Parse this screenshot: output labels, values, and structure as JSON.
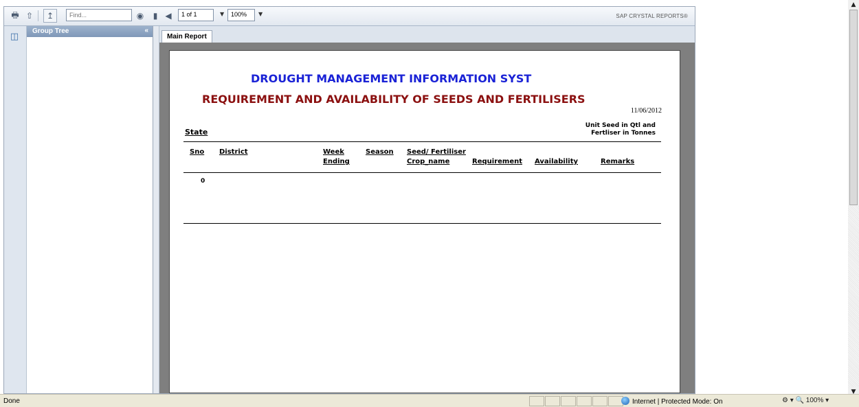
{
  "toolbar": {
    "find_placeholder": "Find...",
    "page_indicator": "1 of 1",
    "zoom": "100%",
    "brand": "SAP CRYSTAL REPORTS®"
  },
  "group_tree": {
    "title": "Group Tree",
    "collapse": "«"
  },
  "tabs": [
    {
      "label": "Main Report"
    }
  ],
  "report": {
    "title1": "DROUGHT MANAGEMENT INFORMATION SYST",
    "title2": "REQUIREMENT AND AVAILABILITY OF SEEDS AND FERTILISERS",
    "date": "11/06/2012",
    "state_label": "State",
    "unit_line1": "Unit Seed in Qtl and",
    "unit_line2": "Fertliser in  Tonnes",
    "columns": {
      "sno": "Sno",
      "district": "District",
      "week1": "Week",
      "week2": "Ending",
      "season": "Season",
      "seed": "Seed/ Fertiliser",
      "crop": "Crop_name",
      "requirement": "Requirement",
      "availability": "Availability",
      "remarks": "Remarks"
    },
    "row_value": "0"
  },
  "statusbar": {
    "left": "Done",
    "zone": "Internet | Protected Mode: On",
    "zoom": "100%"
  }
}
